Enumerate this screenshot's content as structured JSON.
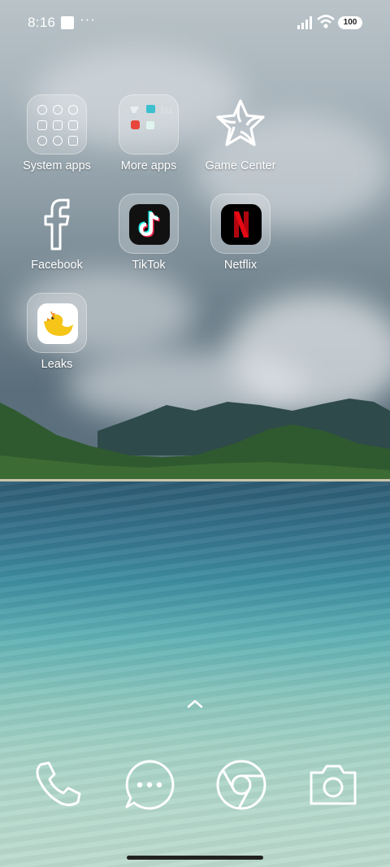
{
  "status_bar": {
    "time": "8:16",
    "battery": "100",
    "icons": [
      "notification-square-icon",
      "more-dots-icon",
      "signal-icon",
      "wifi-icon",
      "battery-icon"
    ]
  },
  "home": {
    "apps": [
      {
        "label": "System apps",
        "icon": "folder-system-apps-icon"
      },
      {
        "label": "More apps",
        "icon": "folder-more-apps-icon"
      },
      {
        "label": "Game Center",
        "icon": "game-center-star-icon"
      },
      {
        "label": "Facebook",
        "icon": "facebook-icon"
      },
      {
        "label": "TikTok",
        "icon": "tiktok-icon"
      },
      {
        "label": "Netflix",
        "icon": "netflix-icon"
      },
      {
        "label": "Leaks",
        "icon": "leaks-bird-icon"
      }
    ],
    "dots": "···"
  },
  "dock": {
    "items": [
      "phone-icon",
      "messages-icon",
      "chrome-icon",
      "camera-icon"
    ]
  },
  "colors": {
    "tiktok_bg": "#111111",
    "netflix_red": "#e50914",
    "leaks_yellow": "#f5c518"
  }
}
